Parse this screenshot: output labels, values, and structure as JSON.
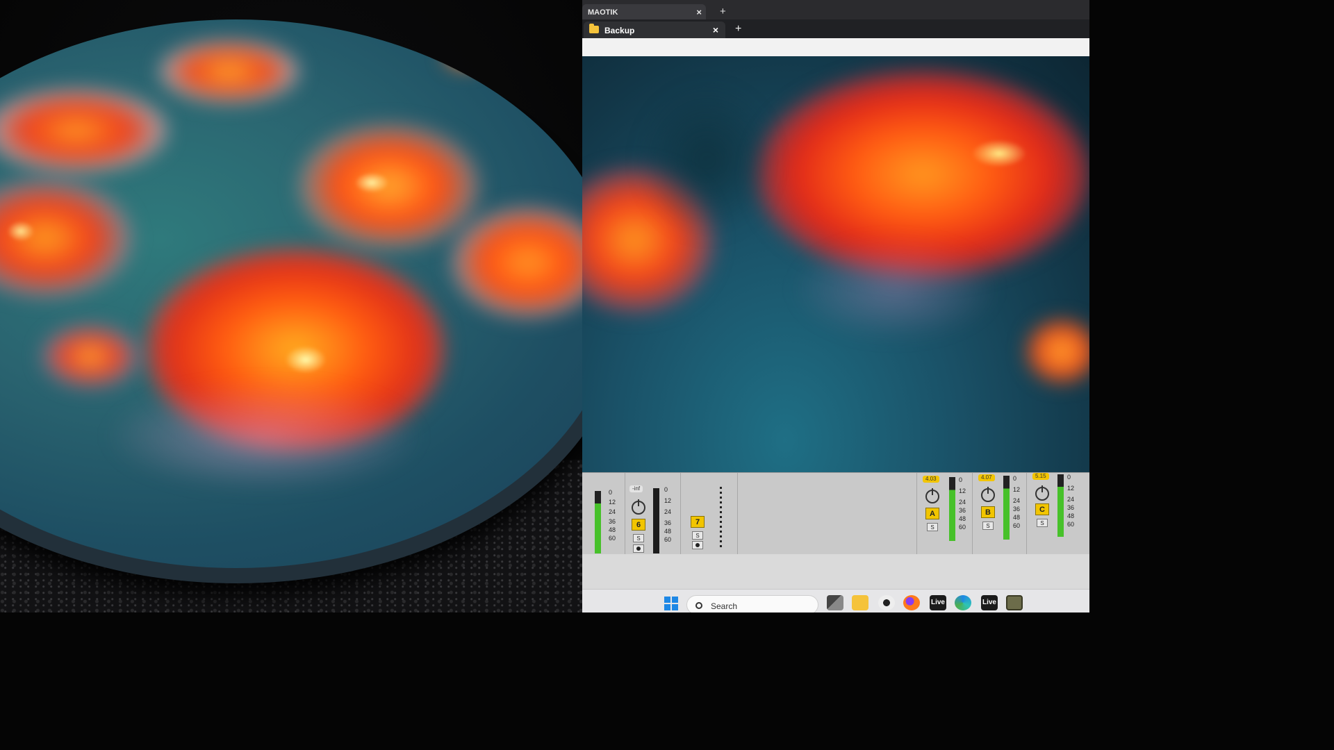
{
  "browser": {
    "tab_back": {
      "title": "MAOTIK",
      "close": "×"
    },
    "new_tab_back": "+",
    "tab_active": {
      "title": "Backup",
      "close": "×"
    },
    "new_tab_active": "+"
  },
  "mixer": {
    "channels": [
      {
        "id": "c5",
        "scale": [
          "0",
          "12",
          "24",
          "36",
          "48",
          "60"
        ]
      },
      {
        "id": "c6",
        "value": "-inf",
        "button": "6",
        "solo": "S",
        "scale": [
          "0",
          "12",
          "24",
          "36",
          "48",
          "60"
        ]
      },
      {
        "id": "c7",
        "button": "7",
        "solo": "S"
      },
      {
        "id": "cA",
        "value": "4.03",
        "button": "A",
        "solo": "S",
        "scale": [
          "0",
          "12",
          "24",
          "36",
          "48",
          "60"
        ]
      },
      {
        "id": "cB",
        "value": "4.07",
        "button": "B",
        "solo": "S",
        "scale": [
          "0",
          "12",
          "24",
          "36",
          "48",
          "60"
        ]
      },
      {
        "id": "cC",
        "value": "5.15",
        "button": "C",
        "solo": "S",
        "scale": [
          "0",
          "12",
          "24",
          "36",
          "48",
          "60"
        ]
      }
    ]
  },
  "taskbar": {
    "search_placeholder": "Search",
    "icons": [
      "windows-start-icon",
      "task-view-icon",
      "file-explorer-icon",
      "alien-app-icon",
      "firefox-icon",
      "ableton-live-icon",
      "edge-icon",
      "ableton-live-icon-2",
      "touchdesigner-icon"
    ],
    "live_label_1": "Live",
    "live_label_2": "Live"
  },
  "colors": {
    "teal": "#1f6f85",
    "orange": "#ff6a12",
    "red": "#e8281a",
    "meter_green": "#47c12a",
    "button_yellow": "#f2c500"
  }
}
